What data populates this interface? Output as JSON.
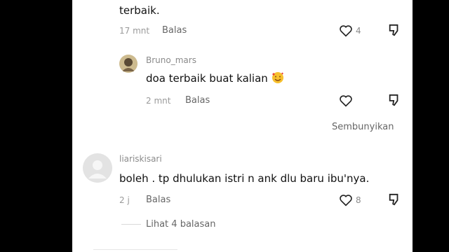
{
  "top_comment": {
    "text_tail": "terbaik.",
    "time": "17 mnt",
    "reply_label": "Balas",
    "like_count": "4"
  },
  "reply": {
    "username": "Bruno_mars",
    "text": "doa terbaik buat kalian",
    "emoji": "smiling-face-with-hearts",
    "time": "2 mnt",
    "reply_label": "Balas",
    "hide_label": "Sembunyikan"
  },
  "comment2": {
    "username": "liariskisari",
    "text": "boleh . tp dhulukan istri n ank dlu baru ibu'nya.",
    "time": "2 j",
    "reply_label": "Balas",
    "like_count": "8",
    "view_replies": "Lihat 4 balasan"
  },
  "colors": {
    "frame": "#000000",
    "panel": "#ffffff",
    "text": "#111111",
    "muted": "#9a9a9a"
  },
  "icons": [
    "heart-icon",
    "dislike-icon",
    "avatar-placeholder-icon"
  ]
}
